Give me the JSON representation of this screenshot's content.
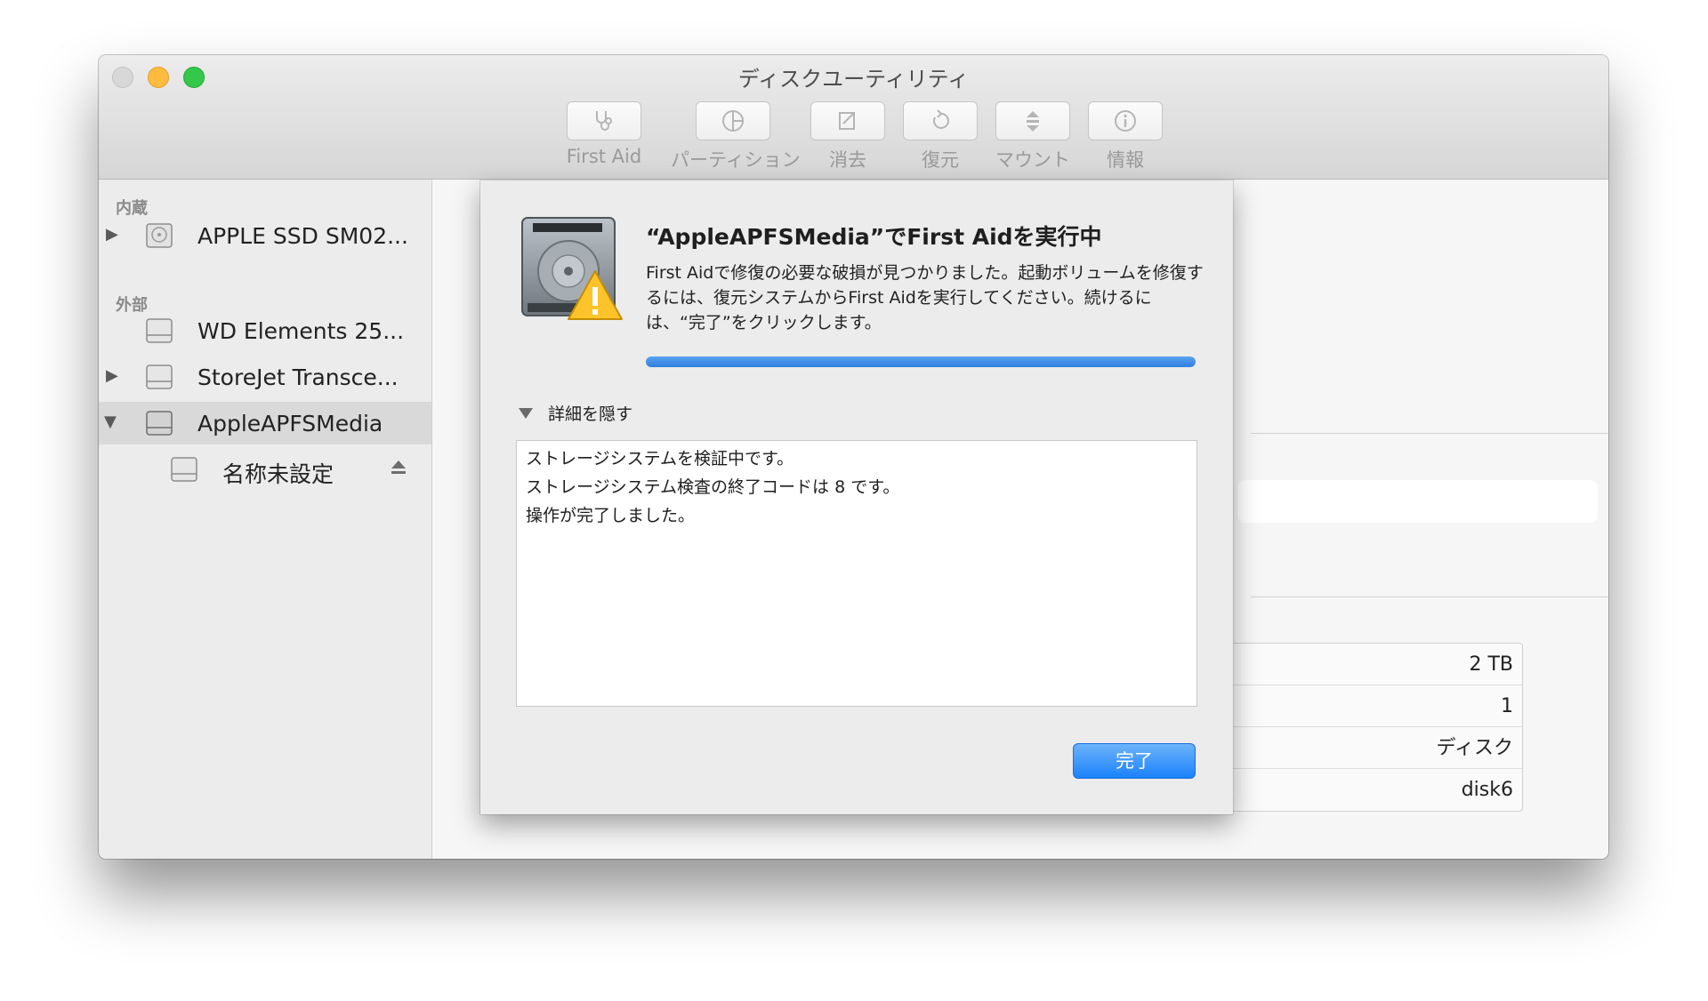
{
  "window": {
    "title": "ディスクユーティリティ"
  },
  "toolbar": {
    "items": [
      {
        "label": "First Aid",
        "icon": "stethoscope-icon"
      },
      {
        "label": "パーティション",
        "icon": "pie-chart-icon"
      },
      {
        "label": "消去",
        "icon": "erase-icon"
      },
      {
        "label": "復元",
        "icon": "restore-icon"
      },
      {
        "label": "マウント",
        "icon": "mount-icon"
      },
      {
        "label": "情報",
        "icon": "info-icon"
      }
    ]
  },
  "sidebar": {
    "internal_heading": "内蔵",
    "external_heading": "外部",
    "items": [
      {
        "label": "APPLE SSD SM02...",
        "icon": "internal-disk-icon"
      },
      {
        "label": "WD Elements 25...",
        "icon": "external-disk-icon"
      },
      {
        "label": "StoreJet Transce...",
        "icon": "external-disk-icon"
      },
      {
        "label": "AppleAPFSMedia",
        "icon": "external-disk-icon",
        "selected": true
      },
      {
        "label": "名称未設定",
        "icon": "volume-icon"
      }
    ]
  },
  "info": {
    "rows": [
      "2 TB",
      "1",
      "ディスク",
      "disk6"
    ]
  },
  "sheet": {
    "title": "“AppleAPFSMedia”でFirst Aidを実行中",
    "message": "First Aidで修復の必要な破損が見つかりました。起動ボリュームを修復するには、復元システムからFirst Aidを実行してください。続けるには、“完了”をクリックします。",
    "progress": 1.0,
    "details_toggle": "詳細を隠す",
    "log_lines": [
      "ストレージシステムを検証中です。",
      "ストレージシステム検査の終了コードは 8 です。",
      "操作が完了しました。"
    ],
    "done_label": "完了"
  },
  "colors": {
    "accent": "#1a82fb",
    "progress": "#3b8ee6",
    "traffic_close": "#d8d8d8",
    "traffic_minimize": "#fdbc40",
    "traffic_zoom": "#34c84a"
  }
}
